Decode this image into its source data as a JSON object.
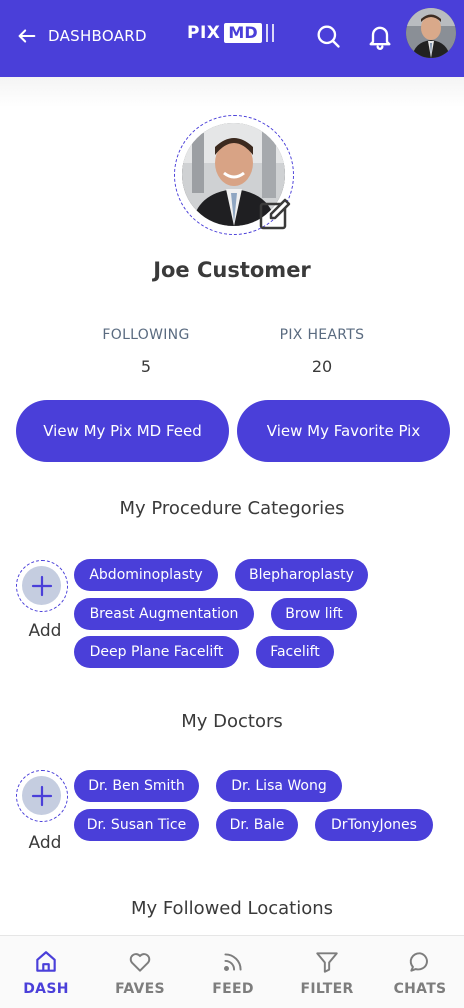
{
  "topbar": {
    "back_label": "DASHBOARD",
    "logo_pix": "PIX",
    "logo_md": "MD",
    "brand_color": "#4a3fd9"
  },
  "profile": {
    "name": "Joe Customer",
    "stats": [
      {
        "label": "FOLLOWING",
        "value": "5"
      },
      {
        "label": "PIX HEARTS",
        "value": "20"
      }
    ],
    "buttons": [
      "View My Pix MD Feed",
      "View My Favorite Pix"
    ]
  },
  "procedures": {
    "title": "My Procedure Categories",
    "add_label": "Add",
    "items": [
      "Abdominoplasty",
      "Blepharoplasty",
      "Breast Augmentation",
      "Brow lift",
      "Deep Plane Facelift",
      "Facelift"
    ]
  },
  "doctors": {
    "title": "My Doctors",
    "add_label": "Add",
    "items": [
      "Dr. Ben Smith",
      "Dr. Lisa Wong",
      "Dr. Susan Tice",
      "Dr. Bale",
      "DrTonyJones"
    ]
  },
  "locations": {
    "title": "My Followed Locations"
  },
  "bottom_nav": [
    {
      "label": "DASH",
      "icon": "home-icon",
      "active": true
    },
    {
      "label": "FAVES",
      "icon": "heart-icon",
      "active": false
    },
    {
      "label": "FEED",
      "icon": "rss-icon",
      "active": false
    },
    {
      "label": "FILTER",
      "icon": "filter-icon",
      "active": false
    },
    {
      "label": "CHATS",
      "icon": "chat-bubble-icon",
      "active": false
    }
  ]
}
